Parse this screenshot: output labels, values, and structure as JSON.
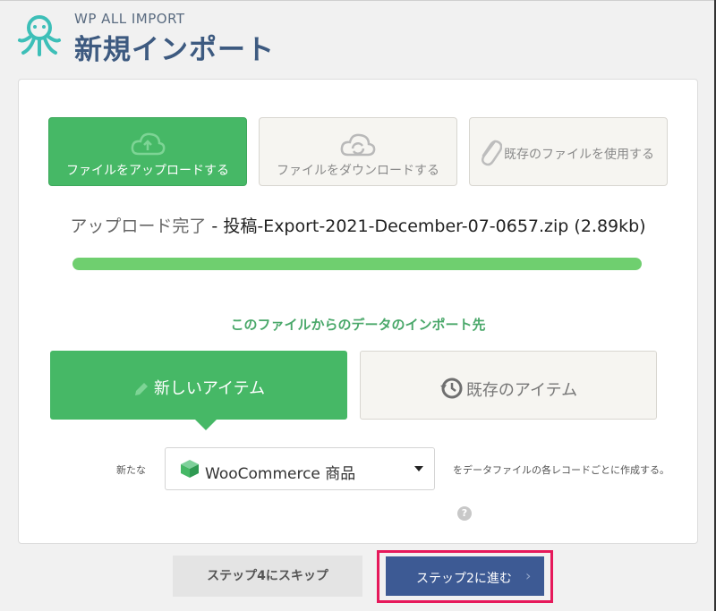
{
  "header": {
    "brand": "WP ALL IMPORT",
    "title": "新規インポート"
  },
  "source_buttons": [
    {
      "label": "ファイルをアップロードする",
      "icon": "cloud-upload-icon",
      "active": true
    },
    {
      "label": "ファイルをダウンロードする",
      "icon": "cloud-download-icon",
      "active": false
    },
    {
      "label": "既存のファイルを使用する",
      "icon": "paperclip-icon",
      "active": false
    }
  ],
  "upload": {
    "status_prefix": "アップロード完了",
    "separator": " - ",
    "filename": "投稿-Export-2021-December-07-0657.zip",
    "size": "(2.89kb)",
    "progress_fraction": 1.0
  },
  "import_section": {
    "label": "このファイルからのデータのインポート先",
    "new_items_label": "新しいアイテム",
    "existing_items_label": "既存のアイテム"
  },
  "post_type": {
    "prefix_label": "新たな",
    "selected": "WooCommerce 商品",
    "suffix_label": "をデータファイルの各レコードごとに作成する。",
    "help_text": "?"
  },
  "footer": {
    "skip_label": "ステップ4にスキップ",
    "next_label": "ステップ2に進む",
    "next_chevron": "›"
  },
  "colors": {
    "accent_green": "#46b866",
    "title_blue": "#3d5a80",
    "next_button": "#3d5a94",
    "highlight": "#e6195b"
  }
}
